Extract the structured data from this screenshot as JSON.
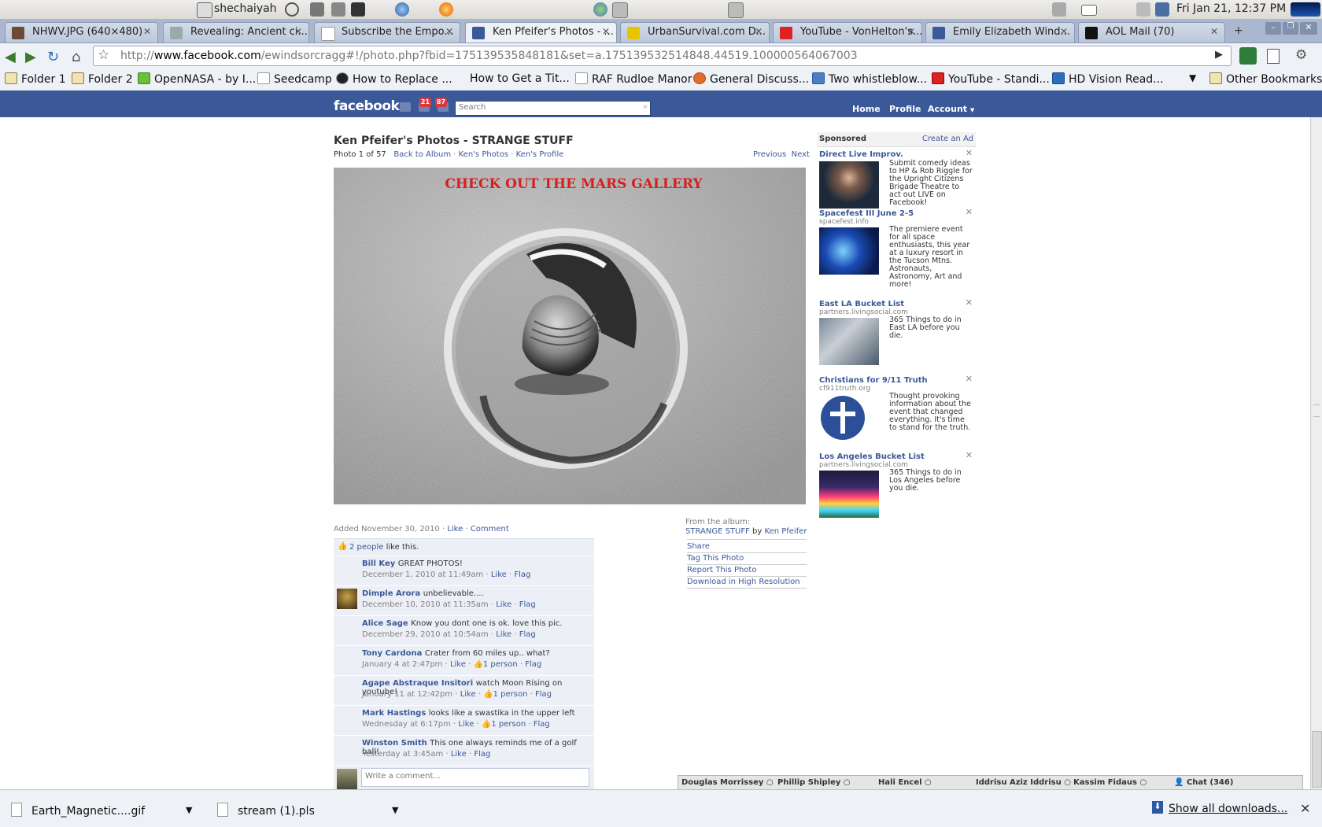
{
  "system": {
    "username": "shechaiyah",
    "clock": "Fri Jan 21, 12:37 PM"
  },
  "tabs": [
    {
      "label": "NHWV.JPG (640×480)",
      "icon": "image-icon"
    },
    {
      "label": "Revealing: Ancient ci...",
      "icon": "page-icon"
    },
    {
      "label": "Subscribe the Empo...",
      "icon": "page-icon"
    },
    {
      "label": "Ken Pfeifer's Photos - ...",
      "icon": "facebook-icon",
      "active": true
    },
    {
      "label": "UrbanSurvival.com D...",
      "icon": "us-icon"
    },
    {
      "label": "YouTube - VonHelton's...",
      "icon": "youtube-icon"
    },
    {
      "label": "Emily Elizabeth Wind...",
      "icon": "facebook-icon"
    },
    {
      "label": "AOL Mail (70)",
      "icon": "aol-icon"
    }
  ],
  "url": {
    "prefix": "http://",
    "domain": "www.facebook.com",
    "rest": "/ewindsorcragg#!/photo.php?fbid=175139535848181&set=a.175139532514848.44519.100000564067003"
  },
  "bookmarks": [
    {
      "label": "Folder 1",
      "type": "folder"
    },
    {
      "label": "Folder 2",
      "type": "folder"
    },
    {
      "label": "OpenNASA - by I...",
      "type": "page"
    },
    {
      "label": "Seedcamp",
      "type": "page"
    },
    {
      "label": "How to Replace ...",
      "type": "page"
    },
    {
      "label": "How to Get a Tit...",
      "type": "page"
    },
    {
      "label": "RAF Rudloe Manor",
      "type": "page"
    },
    {
      "label": "General Discuss...",
      "type": "page"
    },
    {
      "label": "Two whistleblow...",
      "type": "page"
    },
    {
      "label": "YouTube - Standi...",
      "type": "page"
    },
    {
      "label": "HD Vision Read...",
      "type": "page"
    }
  ],
  "other_bookmarks": "Other Bookmarks",
  "facebook": {
    "logo": "facebook",
    "badge_messages": "21",
    "badge_notifications": "87",
    "search_placeholder": "Search",
    "nav": {
      "home": "Home",
      "profile": "Profile",
      "account": "Account"
    }
  },
  "photo_page": {
    "title": "Ken Pfeifer's Photos - STRANGE STUFF",
    "photo_count": "Photo 1 of 57",
    "back_to_album": "Back to Album",
    "kens_photos": "Ken's Photos",
    "kens_profile": "Ken's Profile",
    "previous": "Previous",
    "next": "Next",
    "photo_caption": "CHECK OUT THE MARS GALLERY",
    "added": "Added November 30, 2010",
    "like": "Like",
    "comment": "Comment",
    "likes_people": "2 people",
    "likes_suffix": "like this.",
    "write_comment_placeholder": "Write a comment..."
  },
  "comments": [
    {
      "name": "Bill Key",
      "text": "GREAT PHOTOS!",
      "date": "December 1, 2010 at 11:49am",
      "likes": ""
    },
    {
      "name": "Dimple Arora",
      "text": "unbelievable....",
      "date": "December 10, 2010 at 11:35am",
      "likes": "",
      "avatar": true
    },
    {
      "name": "Alice Sage",
      "text": "Know you dont one is ok. love this pic.",
      "date": "December 29, 2010 at 10:54am",
      "likes": ""
    },
    {
      "name": "Tony Cardona",
      "text": "Crater from 60 miles up.. what?",
      "date": "January 4 at 2:47pm",
      "likes": "1 person"
    },
    {
      "name": "Agape Abstraque Insitori",
      "text": "watch Moon Rising on youtube!",
      "date": "January 11 at 12:42pm",
      "likes": "1 person"
    },
    {
      "name": "Mark Hastings",
      "text": "looks like a swastika in the upper left",
      "date": "Wednesday at 6:17pm",
      "likes": "1 person"
    },
    {
      "name": "Winston Smith",
      "text": "This one always reminds me of a golf ball!",
      "date": "Yesterday at 3:45am",
      "likes": ""
    }
  ],
  "comment_actions": {
    "like": "Like",
    "flag": "Flag"
  },
  "album": {
    "from_label": "From the album:",
    "name": "STRANGE STUFF",
    "by": "by",
    "owner": "Ken Pfeifer",
    "links": [
      "Share",
      "Tag This Photo",
      "Report This Photo",
      "Download in High Resolution"
    ]
  },
  "sponsored": {
    "label": "Sponsored",
    "create_ad": "Create an Ad",
    "ads": [
      {
        "title": "Direct Live Improv.",
        "domain": "",
        "text": "Submit comedy ideas to HP & Rob Riggle for the Upright Citizens Brigade Theatre to act out LIVE on Facebook!"
      },
      {
        "title": "Spacefest III June 2-5",
        "domain": "spacefest.info",
        "text": "The premiere event for all space enthusiasts, this year at a luxury resort in the Tucson Mtns. Astronauts, Astronomy, Art and more!"
      },
      {
        "title": "East LA Bucket List",
        "domain": "partners.livingsocial.com",
        "text": "365 Things to do in East LA before you die."
      },
      {
        "title": "Christians for 9/11 Truth",
        "domain": "cf911truth.org",
        "text": "Thought provoking information about the event that changed everything. It's time to stand for the truth."
      },
      {
        "title": "Los Angeles Bucket List",
        "domain": "partners.livingsocial.com",
        "text": "365 Things to do in Los Angeles before you die."
      }
    ]
  },
  "chat": {
    "people": [
      "Douglas Morrissey",
      "Phillip Shipley",
      "Hali Encel",
      "Iddrisu Aziz Iddrisu",
      "Kassim Fidaus"
    ],
    "chat_label": "Chat (346)"
  },
  "downloads": {
    "items": [
      "Earth_Magnetic....gif",
      "stream (1).pls"
    ],
    "show_all": "Show all downloads..."
  }
}
